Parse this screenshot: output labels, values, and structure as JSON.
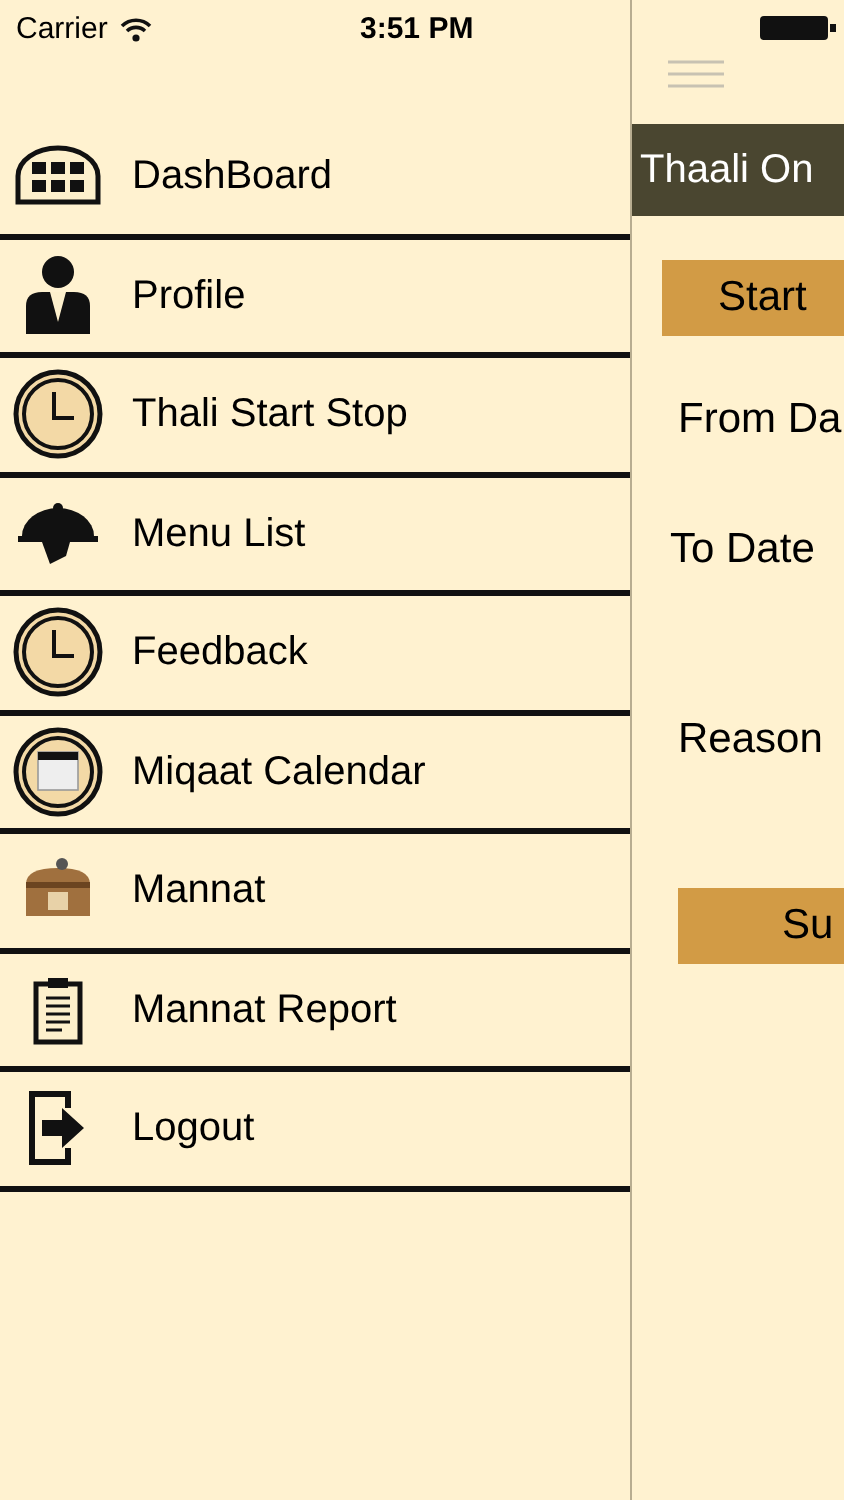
{
  "status_bar": {
    "carrier": "Carrier",
    "time": "3:51 PM"
  },
  "menu": [
    {
      "label": "DashBoard"
    },
    {
      "label": "Profile"
    },
    {
      "label": "Thali Start Stop"
    },
    {
      "label": "Menu List"
    },
    {
      "label": "Feedback"
    },
    {
      "label": "Miqaat Calendar"
    },
    {
      "label": "Mannat"
    },
    {
      "label": "Mannat Report"
    },
    {
      "label": "Logout"
    }
  ],
  "main": {
    "title": "Thaali On",
    "start_button": "Start",
    "from_label": "From Da",
    "to_label": "To Date",
    "reason_label": "Reason",
    "submit_button": "Su"
  }
}
